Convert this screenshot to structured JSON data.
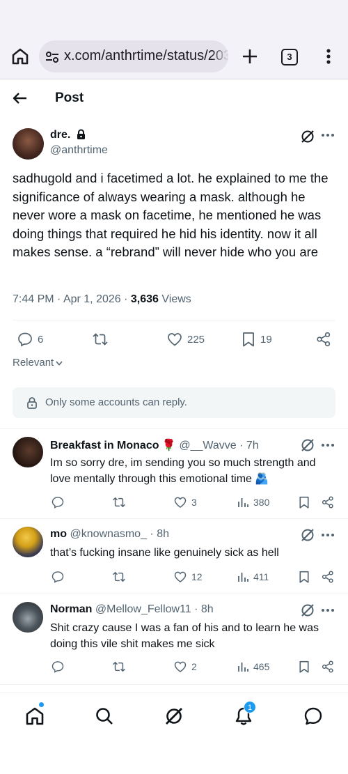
{
  "browser": {
    "url": "x.com/anthrtime/status/203",
    "tab_count": "3"
  },
  "header": {
    "title": "Post"
  },
  "post": {
    "author_name": "dre.",
    "author_handle": "@anthrtime",
    "text": "sadhugold and i facetimed a lot. he explained to me the significance of always wearing a mask. although he never wore a mask on facetime, he mentioned he was doing things that required he hid his identity. now it all makes sense. a “rebrand” will never hide who you are",
    "time": "7:44 PM",
    "date": "Apr 1, 2026",
    "views_count": "3,636",
    "views_label": "Views",
    "replies": "6",
    "likes": "225",
    "bookmarks": "19"
  },
  "sort": {
    "label": "Relevant"
  },
  "reply_restriction": {
    "text": "Only some accounts can reply."
  },
  "replies": [
    {
      "name": "Breakfast in Monaco 🌹",
      "handle": "@__Wavve",
      "time": "7h",
      "text": "Im so sorry dre, im sending you so much strength and love mentally through this emotional time 🫂",
      "likes": "3",
      "views": "380"
    },
    {
      "name": "mo",
      "handle": "@knownasmo_",
      "time": "8h",
      "text": "that’s fucking insane like genuinely sick as hell",
      "likes": "12",
      "views": "411"
    },
    {
      "name": "Norman",
      "handle": "@Mellow_Fellow11",
      "time": "8h",
      "text": "Shit crazy cause I was a fan of his and to learn he was doing this vile shit makes me sick",
      "likes": "2",
      "views": "465"
    }
  ],
  "nav": {
    "notifications_badge": "1"
  },
  "colors": {
    "accent": "#1d9bf0",
    "text_primary": "#0f1419",
    "text_secondary": "#536471",
    "divider": "#eff3f4"
  }
}
